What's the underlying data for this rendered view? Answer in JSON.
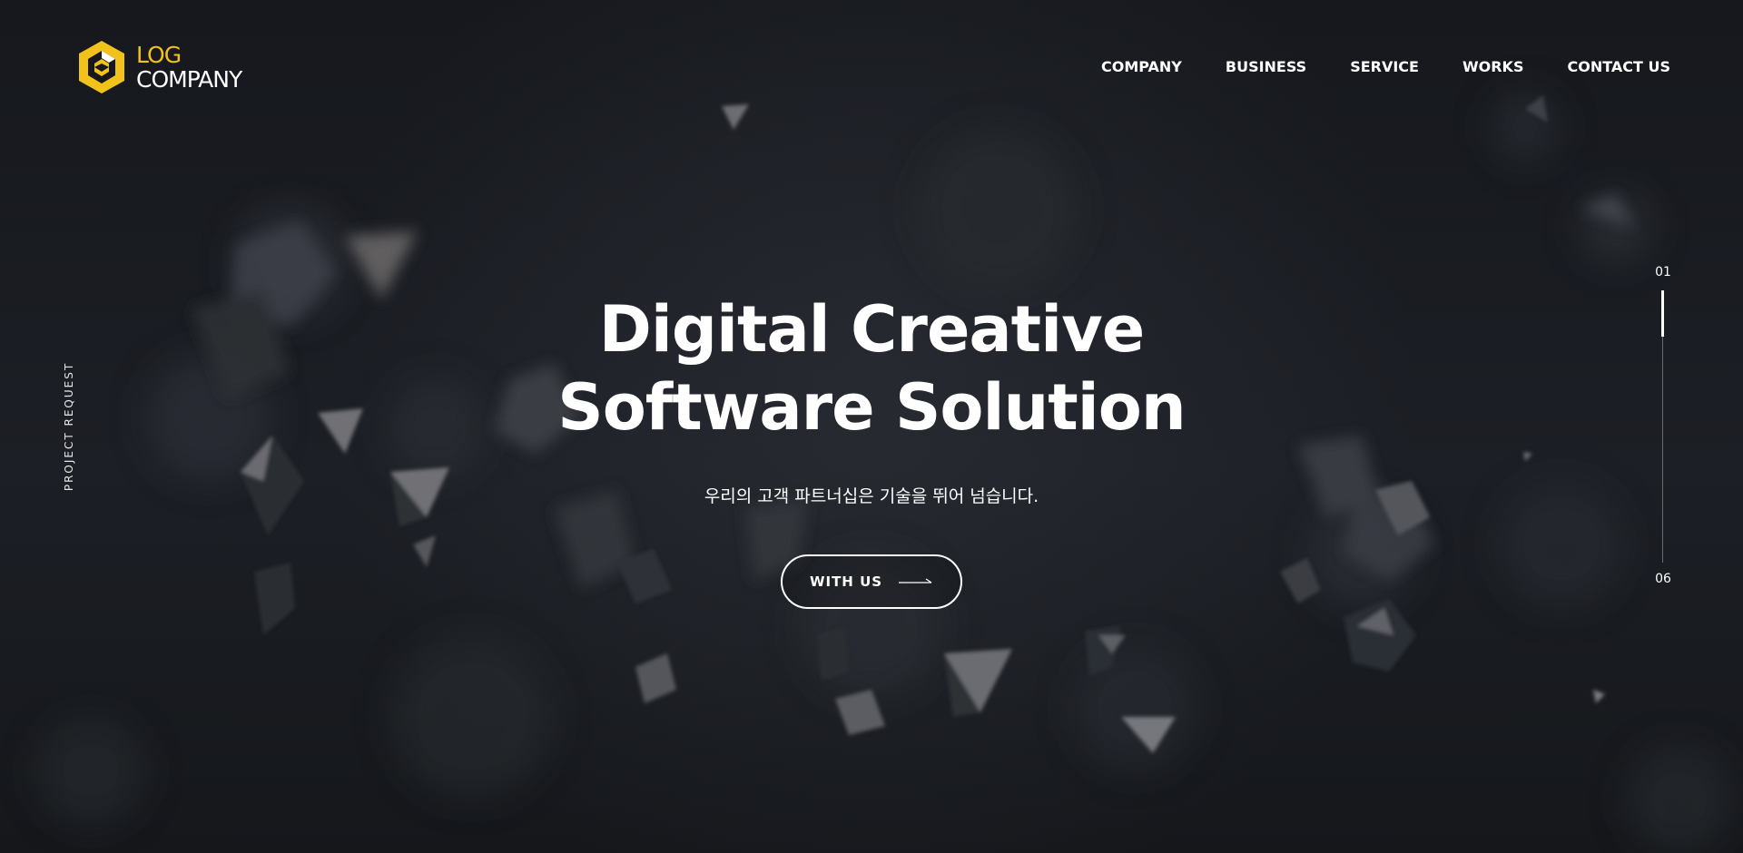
{
  "brand": {
    "name_top": "LOG",
    "name_bottom": "COMPANY",
    "accent_color": "#f1c21b"
  },
  "nav": {
    "items": [
      {
        "label": "COMPANY"
      },
      {
        "label": "BUSINESS"
      },
      {
        "label": "SERVICE"
      },
      {
        "label": "WORKS"
      },
      {
        "label": "CONTACT US"
      }
    ]
  },
  "side": {
    "left_label": "PROJECT REQUEST"
  },
  "hero": {
    "title_line1": "Digital Creative",
    "title_line2": "Software Solution",
    "subtitle": "우리의 고객 파트너십은 기술을 뛰어 넘습니다.",
    "cta_label": "WITH US",
    "cta_icon": "arrow-right-icon"
  },
  "pager": {
    "current": "01",
    "total": "06",
    "progress": 0.17
  },
  "colors": {
    "background": "#16181d",
    "text": "#ffffff"
  }
}
